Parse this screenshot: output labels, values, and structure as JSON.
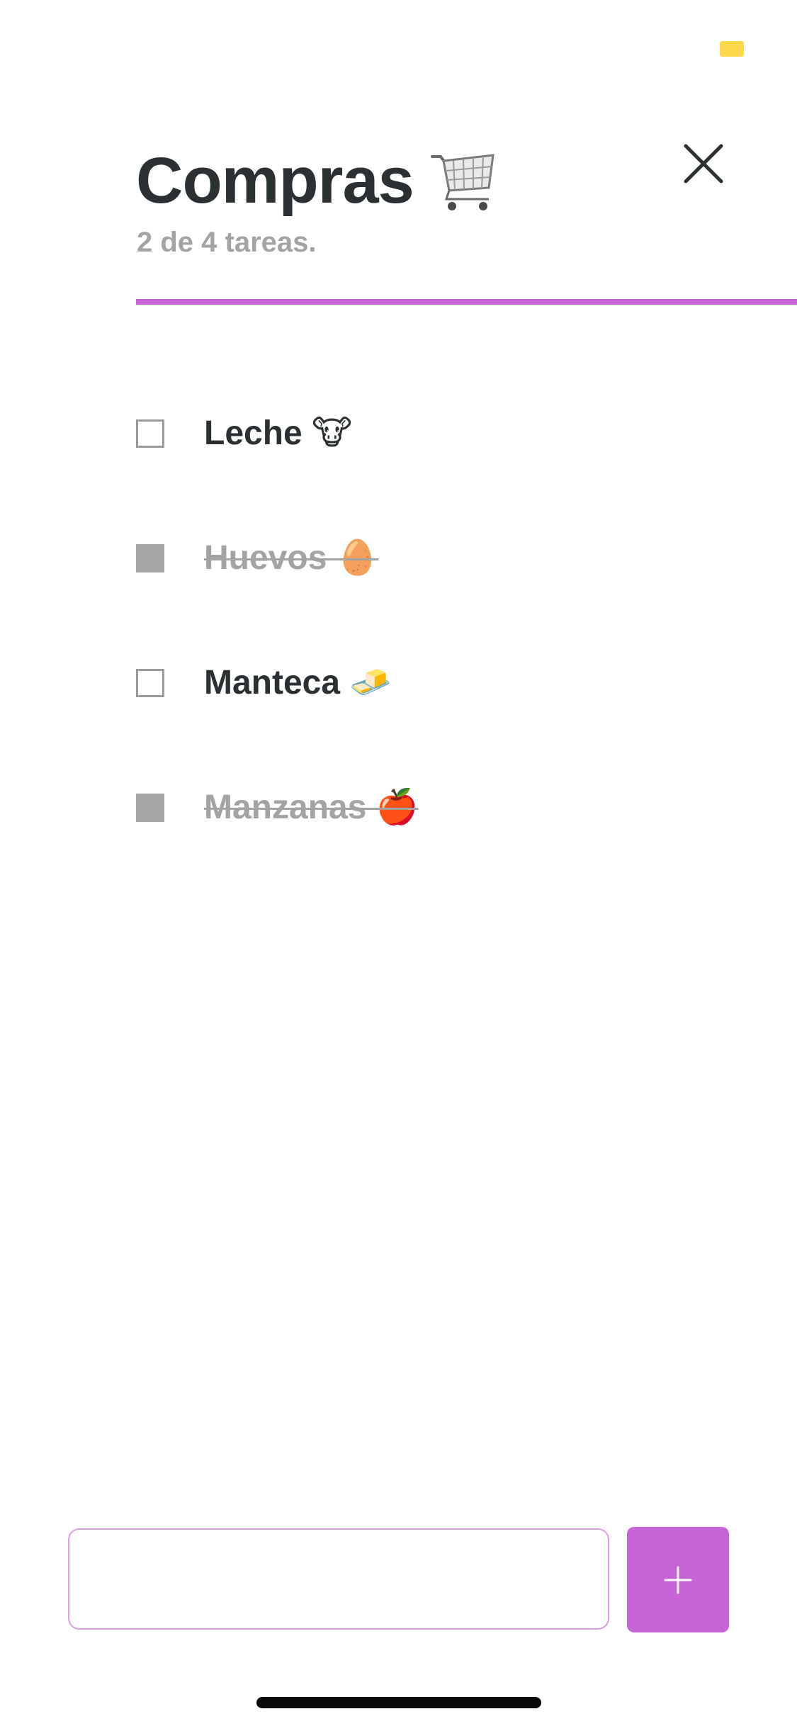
{
  "colors": {
    "accent": "#c663d6",
    "title": "#2b3033",
    "muted": "#a3a3a3",
    "status_indicator": "#fcd84a"
  },
  "header": {
    "title": "Compras",
    "title_emoji_icon": "shopping-cart-icon",
    "subtitle": "2 de 4 tareas.",
    "close_icon": "close-icon"
  },
  "progress": {
    "completed": 2,
    "total": 4
  },
  "tasks": [
    {
      "label": "Leche 🐮",
      "done": false
    },
    {
      "label": "Huevos 🥚",
      "done": true
    },
    {
      "label": "Manteca 🧈",
      "done": false
    },
    {
      "label": "Manzanas 🍎",
      "done": true
    }
  ],
  "composer": {
    "input_value": "",
    "input_placeholder": "",
    "add_icon": "plus-icon"
  }
}
